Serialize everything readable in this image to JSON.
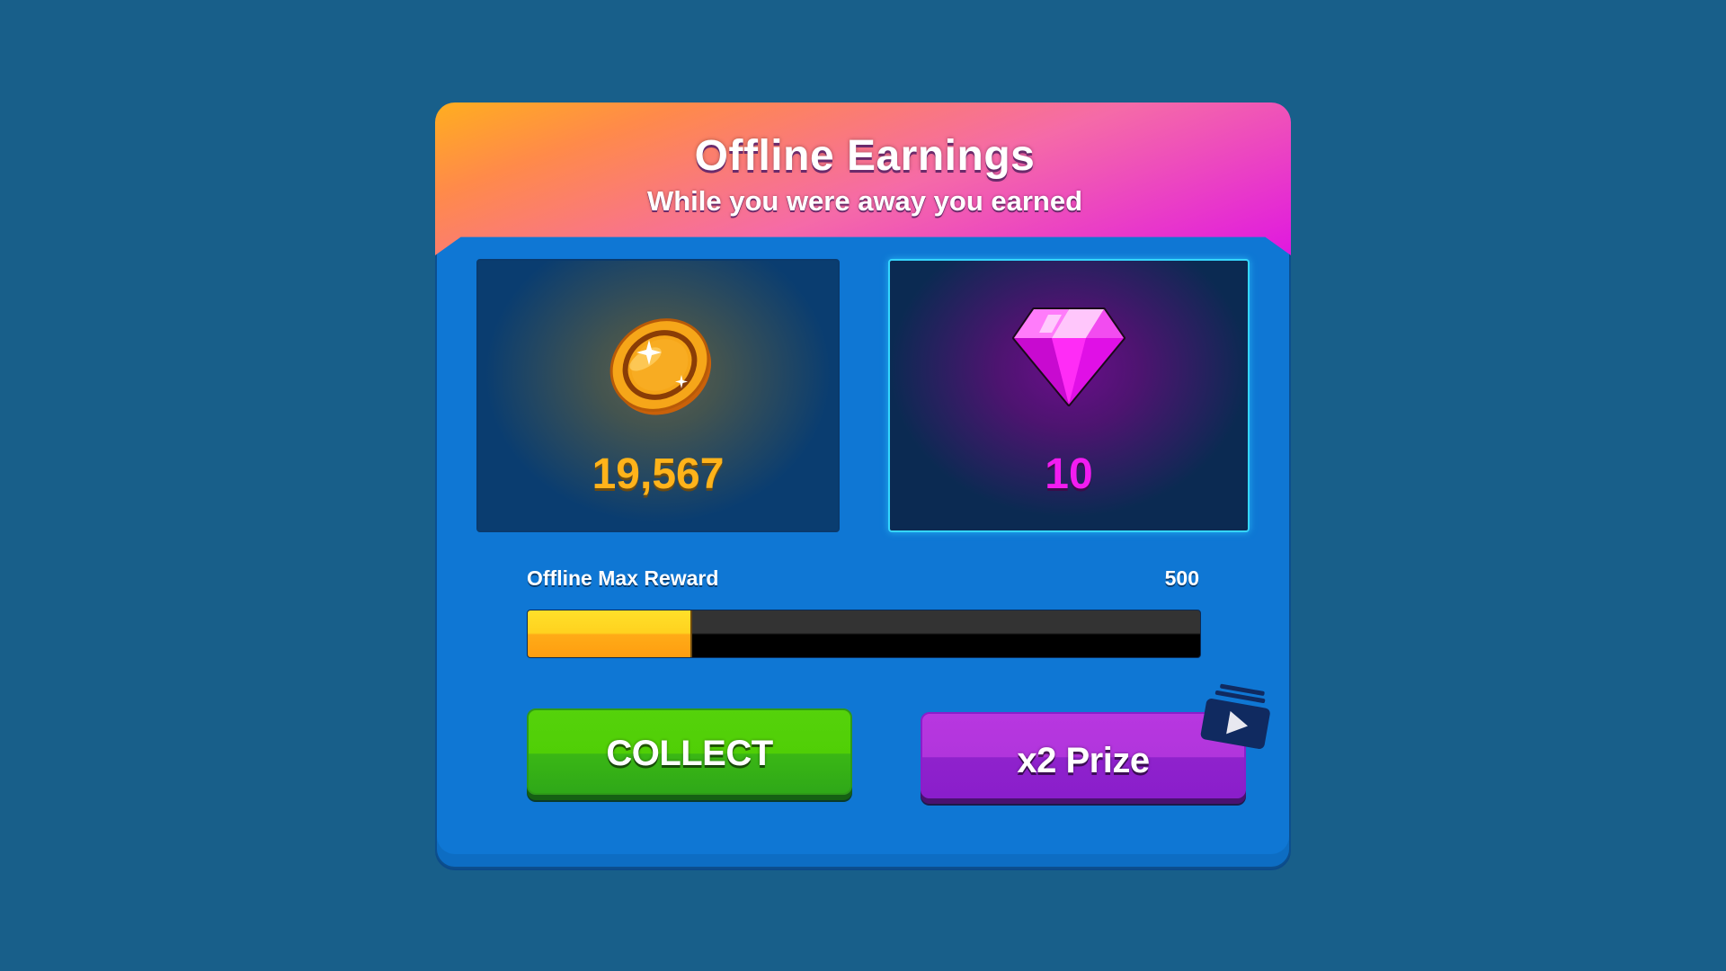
{
  "dialog": {
    "title": "Offline Earnings",
    "subtitle": "While you were away you earned"
  },
  "rewards": {
    "coins": {
      "amount": "19,567",
      "icon": "gold-coin-icon"
    },
    "gems": {
      "amount": "10",
      "icon": "pink-gem-icon",
      "selected": true
    }
  },
  "progress": {
    "label": "Offline Max Reward",
    "max_value": "500",
    "fill_fraction": 0.245
  },
  "buttons": {
    "collect_label": "COLLECT",
    "prize_label": "x2 Prize",
    "prize_icon": "video-ad-icon"
  },
  "colors": {
    "background": "#185f8a",
    "panel": "#0f77d4",
    "coin_text": "#ffb31a",
    "gem_text": "#f21cf0",
    "collect_button": "#50cf06",
    "prize_button": "#b135dc",
    "progress_fill": "#ffd21f"
  }
}
